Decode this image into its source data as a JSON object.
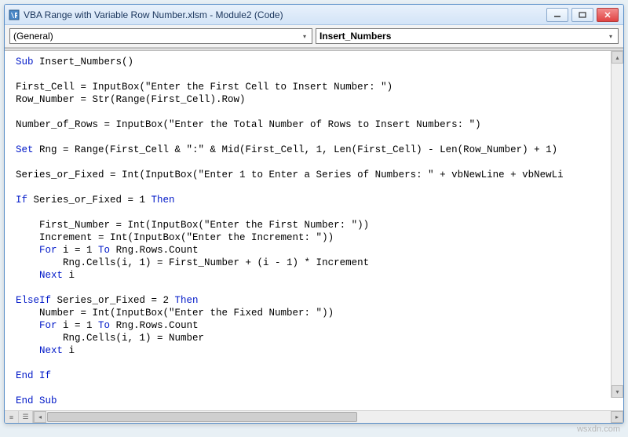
{
  "window": {
    "title": "VBA Range with Variable Row Number.xlsm - Module2 (Code)"
  },
  "dropdowns": {
    "object": "(General)",
    "procedure": "Insert_Numbers"
  },
  "code": {
    "lines": [
      {
        "t": "kw",
        "v": "Sub"
      },
      {
        "t": "p",
        "v": " Insert_Numbers()"
      }
    ]
  },
  "code_lines": [
    "Sub Insert_Numbers()",
    "",
    "First_Cell = InputBox(\"Enter the First Cell to Insert Number: \")",
    "Row_Number = Str(Range(First_Cell).Row)",
    "",
    "Number_of_Rows = InputBox(\"Enter the Total Number of Rows to Insert Numbers: \")",
    "",
    "Set Rng = Range(First_Cell & \":\" & Mid(First_Cell, 1, Len(First_Cell) - Len(Row_Number) + 1)",
    "",
    "Series_or_Fixed = Int(InputBox(\"Enter 1 to Enter a Series of Numbers: \" + vbNewLine + vbNewLi",
    "",
    "If Series_or_Fixed = 1 Then",
    "",
    "    First_Number = Int(InputBox(\"Enter the First Number: \"))",
    "    Increment = Int(InputBox(\"Enter the Increment: \"))",
    "    For i = 1 To Rng.Rows.Count",
    "        Rng.Cells(i, 1) = First_Number + (i - 1) * Increment",
    "    Next i",
    "",
    "ElseIf Series_or_Fixed = 2 Then",
    "    Number = Int(InputBox(\"Enter the Fixed Number: \"))",
    "    For i = 1 To Rng.Rows.Count",
    "        Rng.Cells(i, 1) = Number",
    "    Next i",
    "",
    "End If",
    "",
    "End Sub"
  ],
  "watermark": "wsxdn.com"
}
